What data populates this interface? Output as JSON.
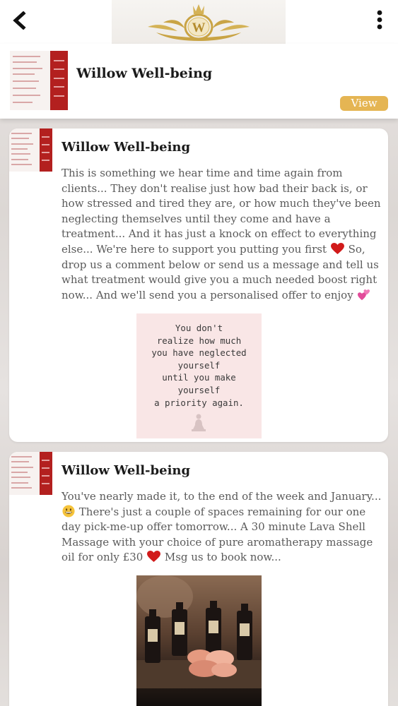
{
  "topbar": {
    "back_icon": "back-arrow-icon",
    "logo_letter": "W",
    "more_icon": "more-vertical-icon"
  },
  "business": {
    "name": "Willow Well-being",
    "view_label": "View",
    "accent_color": "#e5b553"
  },
  "posts": [
    {
      "author": "Willow Well-being",
      "text_part1": "This is something we hear time and time again from clients... They don't realise just how bad their back is, or how stressed and tired they are, or how much they've been neglecting themselves until they come and have a treatment... And it has just a knock on effect to everything else... We're here to support you putting you first",
      "text_part2": "So, drop us a comment below or send us a message and tell us what treatment would give you a much needed boost right now... And we'll send you a personalised offer to enjoy",
      "image_text": "You don't\nrealize how much\nyou have neglected\nyourself\nuntil you make\nyourself\na priority again."
    },
    {
      "author": "Willow Well-being",
      "text_part1": "You've nearly made it, to the end of the week and January...",
      "text_part2": "There's just a couple of spaces remaining for our one day pick-me-up offer tomorrow... A 30 minute Lava Shell Massage with your choice of pure aromatherapy massage oil for only £30",
      "text_part3": "Msg us to book now..."
    }
  ]
}
